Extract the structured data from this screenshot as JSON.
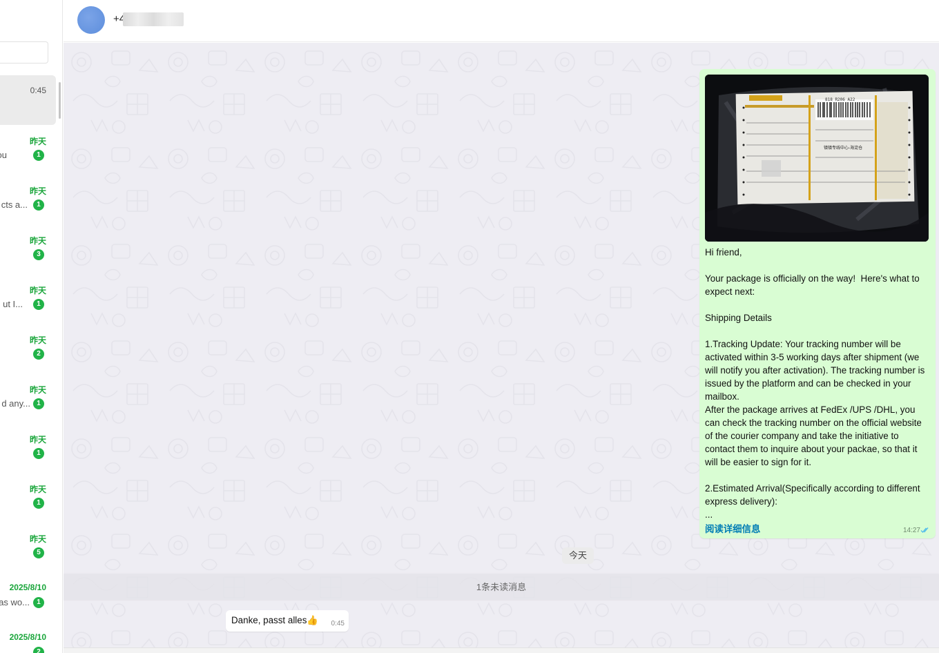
{
  "sidebar": {
    "items": [
      {
        "time": "0:45",
        "preview": "",
        "badge": ""
      },
      {
        "time": "昨天",
        "preview": "you",
        "badge": "1"
      },
      {
        "time": "昨天",
        "preview": "cts a...",
        "badge": "1"
      },
      {
        "time": "昨天",
        "preview": "",
        "badge": "3"
      },
      {
        "time": "昨天",
        "preview": "ut I...",
        "badge": "1"
      },
      {
        "time": "昨天",
        "preview": "",
        "badge": "2"
      },
      {
        "time": "昨天",
        "preview": "d any...",
        "badge": "1"
      },
      {
        "time": "昨天",
        "preview": "",
        "badge": "1"
      },
      {
        "time": "昨天",
        "preview": "",
        "badge": "1"
      },
      {
        "time": "昨天",
        "preview": "",
        "badge": "5"
      },
      {
        "time": "2025/8/10",
        "preview": "as wo...",
        "badge": "1"
      },
      {
        "time": "2025/8/10",
        "preview": "",
        "badge": "2"
      }
    ]
  },
  "header": {
    "contact_name": "+4"
  },
  "messages": {
    "outgoing": {
      "text": "Hi friend,\n\nYour package is officially on the way!  Here's what to expect next:\n\nShipping Details\n\n1.Tracking Update: Your tracking number will be activated within 3-5 working days after shipment (we will notify you after activation). The tracking number is issued by the platform and can be checked in your mailbox.\nAfter the package arrives at FedEx /UPS /DHL, you can check the tracking number on the official website of the courier company and take the initiative to contact them to inquire about your packae, so that it will be easier to sign for it.\n\n2.Estimated Arrival(Specifically according to different express delivery):\n...",
      "read_more": "阅读详细信息",
      "time": "14:27",
      "photo_label_text": "818 R206 A22",
      "photo_label_line": "镇镇专线中心-海淀仓"
    },
    "date_chip": "今天",
    "unread_divider": "1条未读消息",
    "incoming": {
      "text": "Danke, passt alles👍",
      "time": "0:45"
    }
  },
  "colors": {
    "outgoing_bubble": "#d9fdd3",
    "badge": "#21b348",
    "link": "#027eb5",
    "chat_bg": "#eeedf3"
  }
}
